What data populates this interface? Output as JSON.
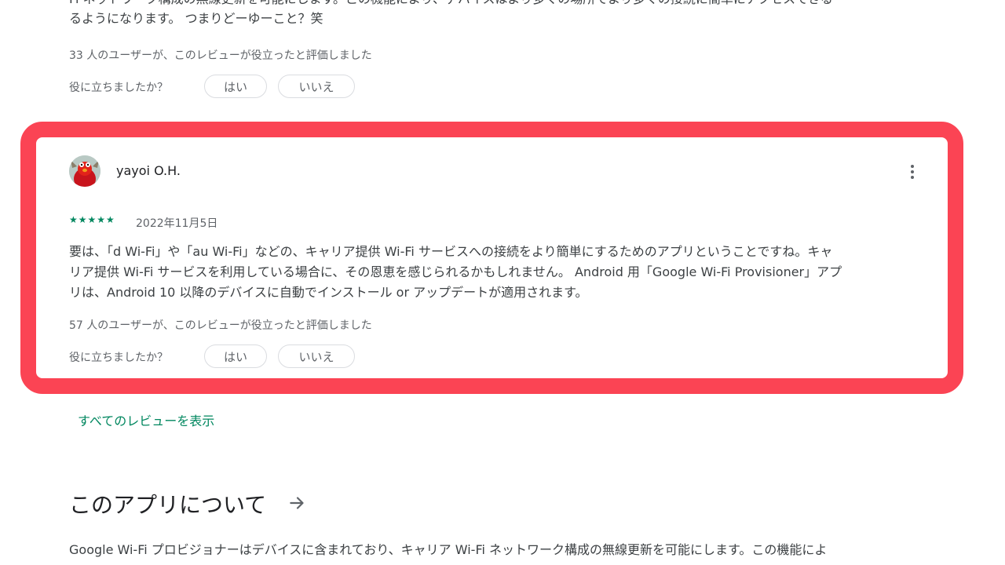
{
  "previous_review": {
    "text_lines": [
      "Fi ネットワーク構成の無線更新を可能にします。この機能により、デバイスはより多くの場所でより多くの接続に簡単にアクセスできる",
      "るようになります。 つまりどーゆーこと？笑"
    ],
    "helpful_count_text": "33 人のユーザーが、このレビューが役立ったと評価しました",
    "helpful_question": "役に立ちましたか？",
    "yes_label": "はい",
    "no_label": "いいえ"
  },
  "review": {
    "reviewer_name": "yayoi O.H.",
    "rating": 5,
    "stars_display": "★★★★★",
    "date": "2022年11月5日",
    "body_lines": [
      "要は、「d Wi-Fi」や「au Wi-Fi」などの、キャリア提供 Wi-Fi サービスへの接続をより簡単にするためのアプリということですね。キャ",
      "リア提供 Wi-Fi サービスを利用している場合に、その恩恵を感じられるかもしれません。 Android 用「Google Wi-Fi Provisioner」アプ",
      "リは、Android 10 以降のデバイスに自動でインストール or アップデートが適用されます。"
    ],
    "helpful_count_text": "57 人のユーザーが、このレビューが役立ったと評価しました",
    "helpful_question": "役に立ちましたか？",
    "yes_label": "はい",
    "no_label": "いいえ",
    "more_options_icon": "more-vert-icon",
    "highlight_color": "#fb4454"
  },
  "see_all_reviews": "すべてのレビューを表示",
  "about": {
    "title": "このアプリについて",
    "arrow_icon": "arrow-right-icon",
    "description": "Google Wi-Fi プロビジョナーはデバイスに含まれており、キャリア Wi-Fi ネットワーク構成の無線更新を可能にします。この機能によ"
  },
  "colors": {
    "accent_green": "#01875f",
    "text": "#3c4043",
    "highlight_red": "#fb4454"
  }
}
